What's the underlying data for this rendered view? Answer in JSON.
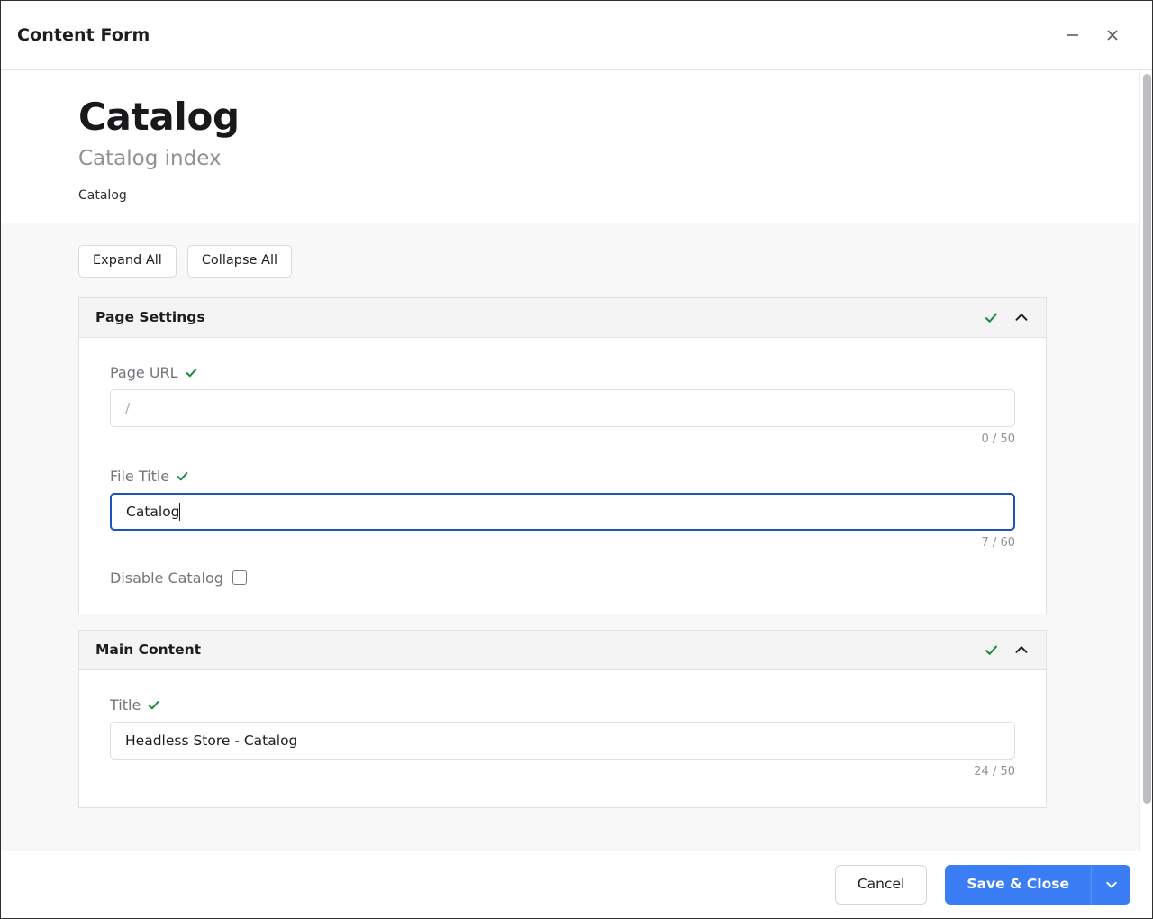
{
  "window": {
    "title": "Content Form",
    "minimize_icon": "minimize-icon",
    "close_icon": "close-icon"
  },
  "page": {
    "title": "Catalog",
    "subtitle": "Catalog index",
    "breadcrumb": "Catalog"
  },
  "toolbar": {
    "expand_all_label": "Expand All",
    "collapse_all_label": "Collapse All"
  },
  "colors": {
    "accent_blue": "#3b7df5",
    "focus_border": "#1c52c0",
    "valid_green": "#1f8a45",
    "body_background": "#f8f8f9",
    "panel_header_background": "#f4f4f5"
  },
  "sections": [
    {
      "title": "Page Settings",
      "valid_icon": "check-icon",
      "collapse_icon": "chevron-up-icon",
      "fields": [
        {
          "label": "Page URL",
          "valid_icon": "check-icon",
          "value": "",
          "placeholder": "/",
          "counter": "0 / 50",
          "focused": false
        },
        {
          "label": "File Title",
          "valid_icon": "check-icon",
          "value": "Catalog",
          "placeholder": "",
          "counter": "7 / 60",
          "focused": true
        }
      ],
      "checkbox": {
        "label": "Disable Catalog",
        "checked": false
      }
    },
    {
      "title": "Main Content",
      "valid_icon": "check-icon",
      "collapse_icon": "chevron-up-icon",
      "fields": [
        {
          "label": "Title",
          "valid_icon": "check-icon",
          "value": "Headless Store - Catalog",
          "placeholder": "",
          "counter": "24 / 50",
          "focused": false
        }
      ]
    }
  ],
  "footer": {
    "cancel_label": "Cancel",
    "save_label": "Save & Close",
    "save_dropdown_icon": "chevron-down-icon"
  }
}
